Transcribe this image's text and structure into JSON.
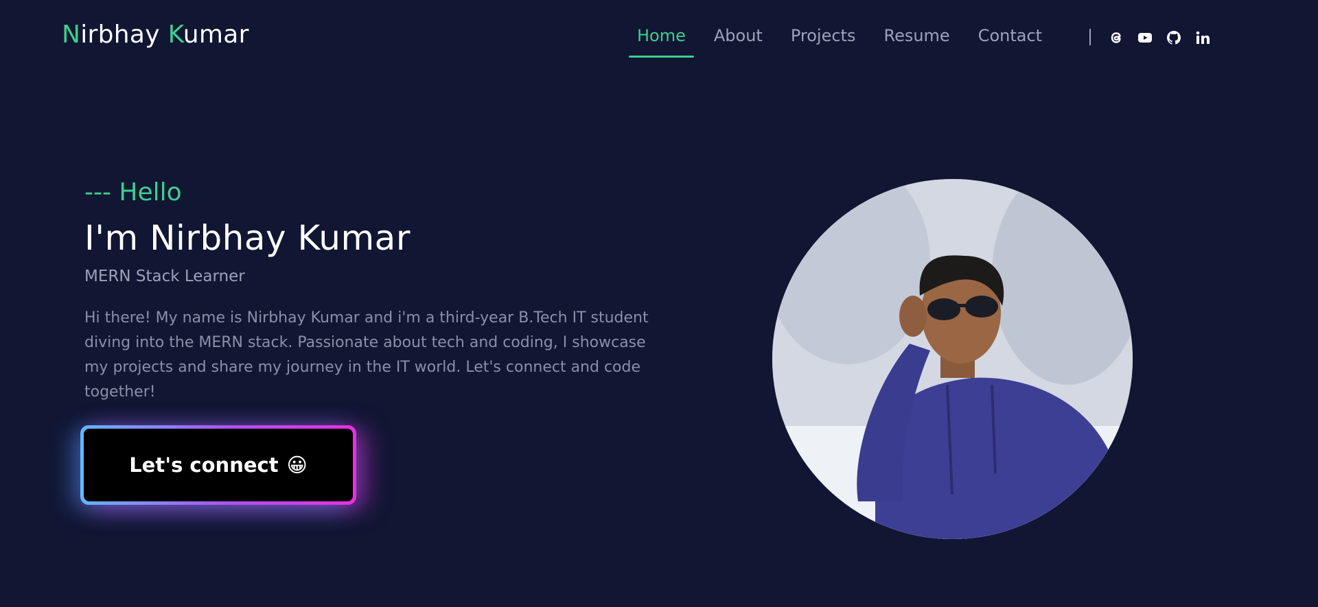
{
  "header": {
    "logo_first_initial": "N",
    "logo_first_rest": "irbhay ",
    "logo_last_initial": "K",
    "logo_last_rest": "umar"
  },
  "nav": {
    "items": [
      {
        "label": "Home",
        "active": true
      },
      {
        "label": "About",
        "active": false
      },
      {
        "label": "Projects",
        "active": false
      },
      {
        "label": "Resume",
        "active": false
      },
      {
        "label": "Contact",
        "active": false
      }
    ]
  },
  "social": {
    "icons": [
      "threads-icon",
      "youtube-icon",
      "github-icon",
      "linkedin-icon"
    ]
  },
  "hero": {
    "greeting": "--- Hello",
    "name": "I'm Nirbhay Kumar",
    "role": "MERN Stack Learner",
    "bio": "Hi there! My name is Nirbhay Kumar and i'm a third-year B.Tech IT student diving into the MERN stack. Passionate about tech and coding, I showcase my projects and share my journey in the IT world. Let's connect and code together!",
    "cta_label": "Let's connect",
    "cta_emoji": "😀"
  },
  "colors": {
    "background": "#111633",
    "accent": "#3ecf8e",
    "muted_text": "#9ca3b8",
    "cta_gradient_start": "#60b8ff",
    "cta_gradient_end": "#ea2fe0"
  }
}
